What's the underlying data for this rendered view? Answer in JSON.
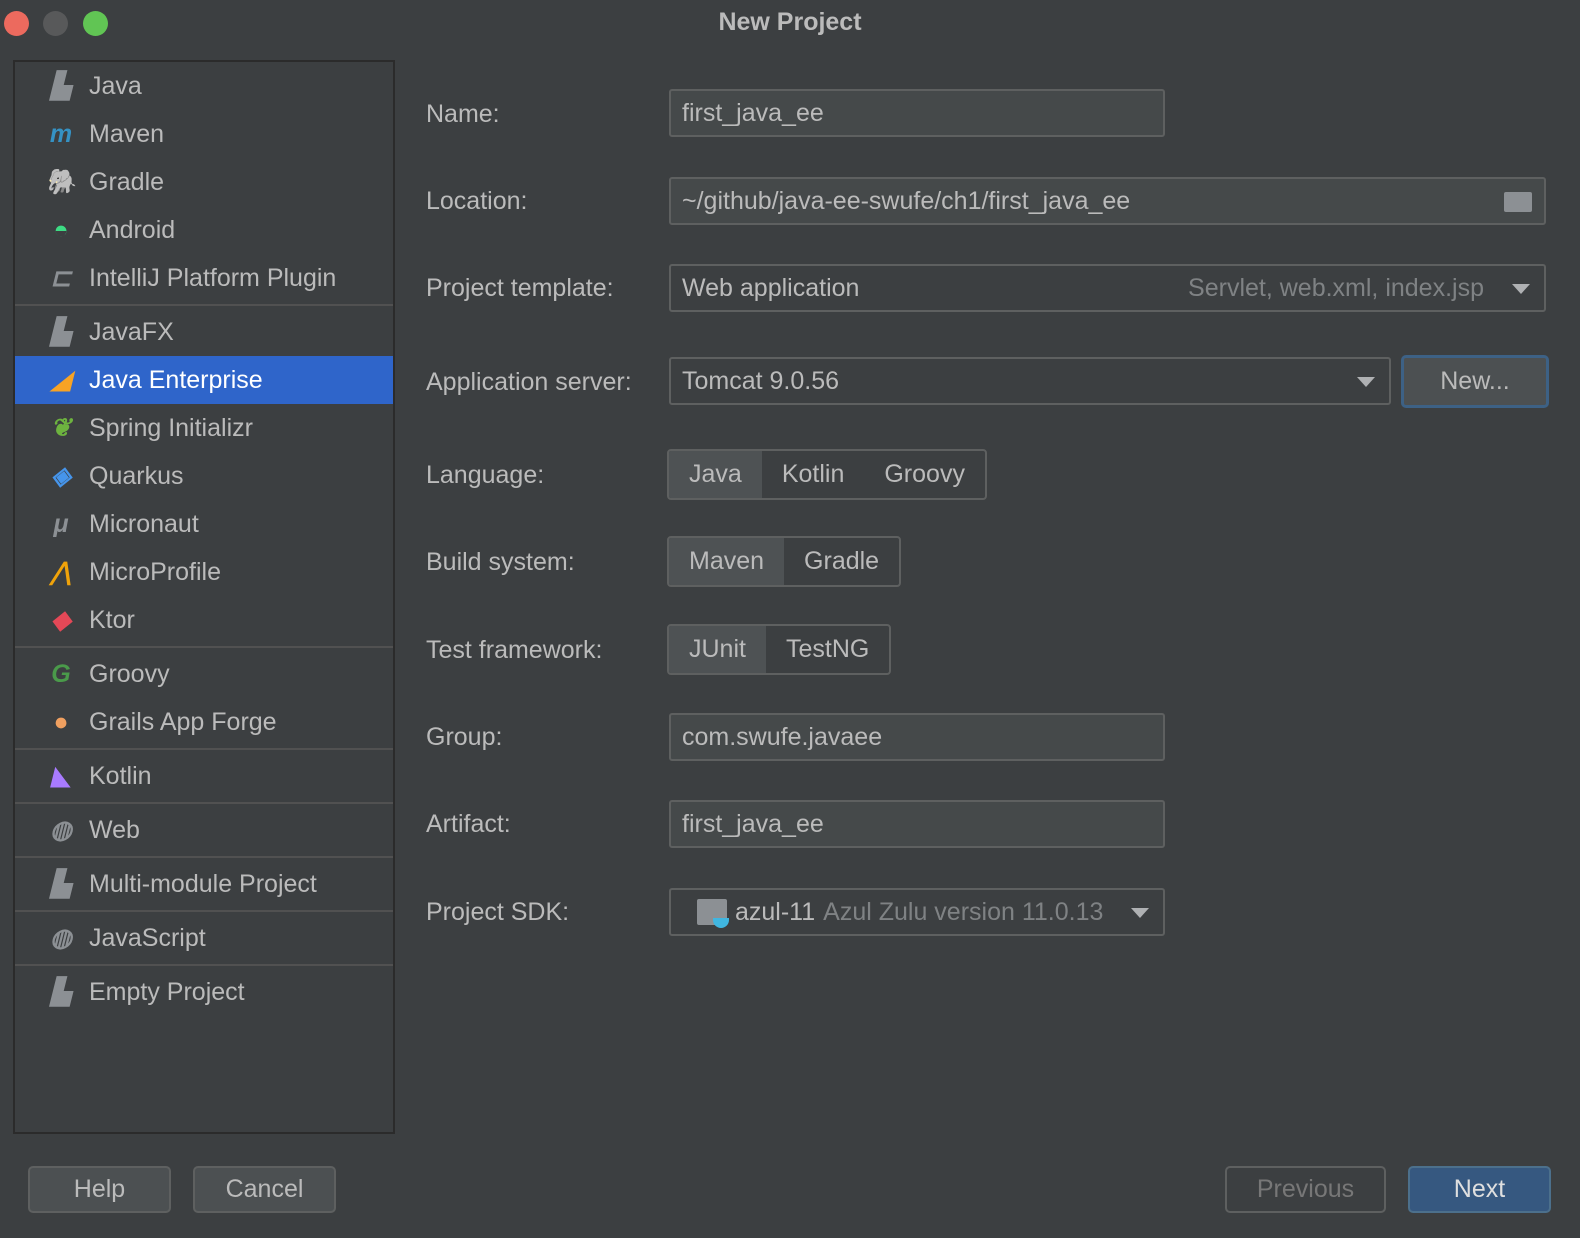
{
  "window": {
    "title": "New Project"
  },
  "sidebar": {
    "groups": [
      [
        {
          "label": "Java",
          "icon": "java-folder-icon"
        },
        {
          "label": "Maven",
          "icon": "maven-icon"
        },
        {
          "label": "Gradle",
          "icon": "gradle-icon"
        },
        {
          "label": "Android",
          "icon": "android-icon"
        },
        {
          "label": "IntelliJ Platform Plugin",
          "icon": "plugin-icon"
        }
      ],
      [
        {
          "label": "JavaFX",
          "icon": "javafx-folder-icon"
        },
        {
          "label": "Java Enterprise",
          "icon": "java-enterprise-icon",
          "selected": true
        },
        {
          "label": "Spring Initializr",
          "icon": "spring-icon"
        },
        {
          "label": "Quarkus",
          "icon": "quarkus-icon"
        },
        {
          "label": "Micronaut",
          "icon": "micronaut-icon"
        },
        {
          "label": "MicroProfile",
          "icon": "microprofile-icon"
        },
        {
          "label": "Ktor",
          "icon": "ktor-icon"
        }
      ],
      [
        {
          "label": "Groovy",
          "icon": "groovy-icon"
        },
        {
          "label": "Grails App Forge",
          "icon": "grails-icon"
        }
      ],
      [
        {
          "label": "Kotlin",
          "icon": "kotlin-icon"
        }
      ],
      [
        {
          "label": "Web",
          "icon": "globe-icon"
        }
      ],
      [
        {
          "label": "Multi-module Project",
          "icon": "folder-icon"
        }
      ],
      [
        {
          "label": "JavaScript",
          "icon": "globe-icon"
        }
      ],
      [
        {
          "label": "Empty Project",
          "icon": "folder-icon"
        }
      ]
    ]
  },
  "form": {
    "name_label": "Name:",
    "name_value": "first_java_ee",
    "location_label": "Location:",
    "location_value": "~/github/java-ee-swufe/ch1/first_java_ee",
    "template_label": "Project template:",
    "template_value": "Web application",
    "template_hint": "Servlet, web.xml, index.jsp",
    "server_label": "Application server:",
    "server_value": "Tomcat 9.0.56",
    "server_new": "New...",
    "language_label": "Language:",
    "language_options": [
      "Java",
      "Kotlin",
      "Groovy"
    ],
    "build_label": "Build system:",
    "build_options": [
      "Maven",
      "Gradle"
    ],
    "test_label": "Test framework:",
    "test_options": [
      "JUnit",
      "TestNG"
    ],
    "group_label": "Group:",
    "group_value": "com.swufe.javaee",
    "artifact_label": "Artifact:",
    "artifact_value": "first_java_ee",
    "sdk_label": "Project SDK:",
    "sdk_name": "azul-11",
    "sdk_version": "Azul Zulu version 11.0.13"
  },
  "footer": {
    "help": "Help",
    "cancel": "Cancel",
    "previous": "Previous",
    "next": "Next"
  },
  "colors": {
    "selected": "#2f65ca",
    "background": "#3c3f41"
  }
}
